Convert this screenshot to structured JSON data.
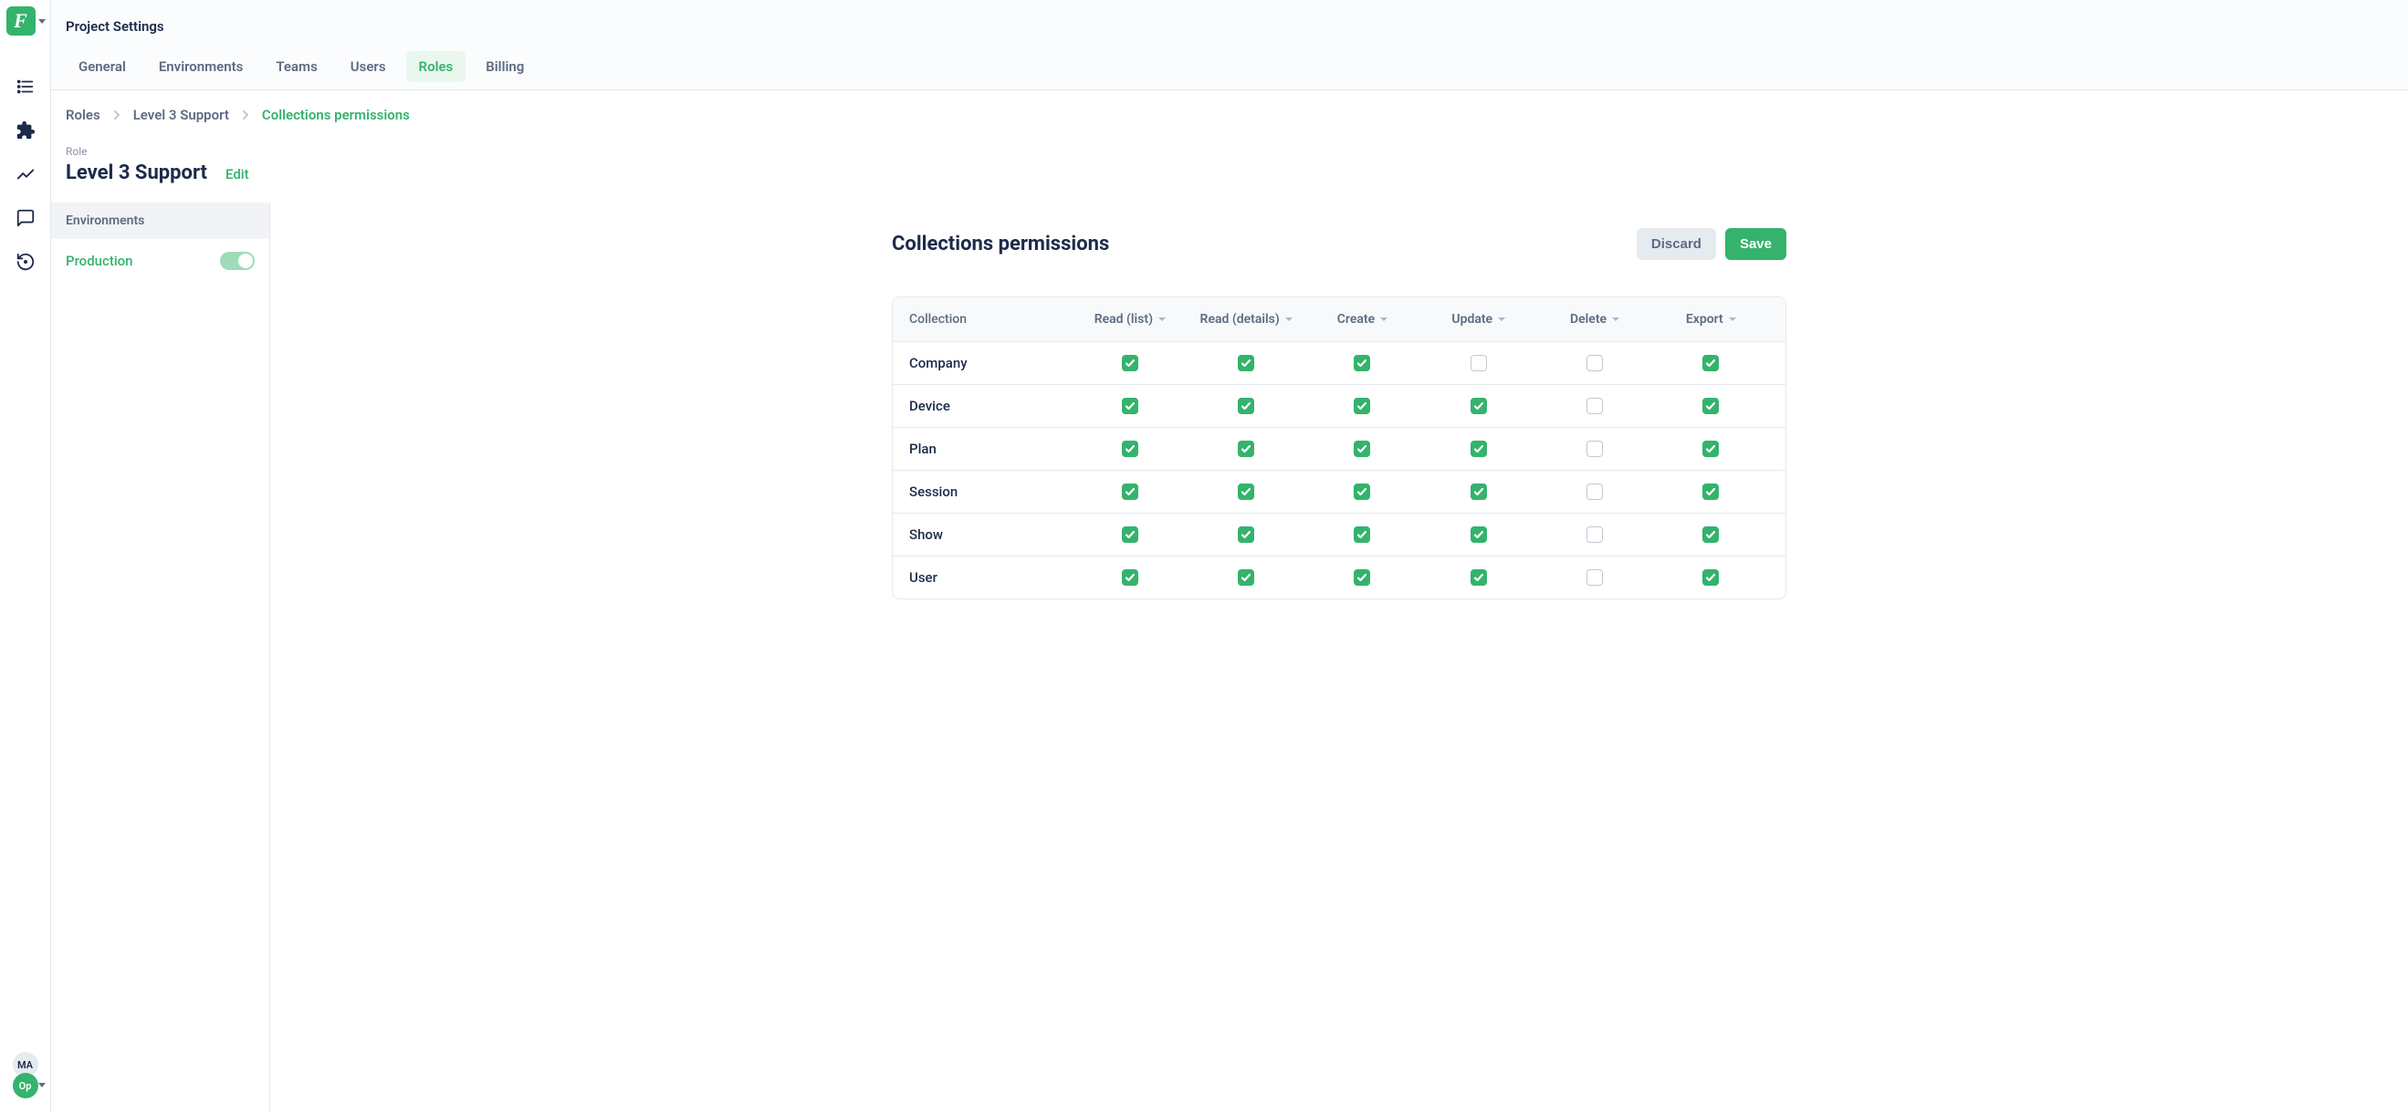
{
  "logo_letter": "F",
  "page_context": "Project Settings",
  "tabs": [
    {
      "label": "General",
      "active": false
    },
    {
      "label": "Environments",
      "active": false
    },
    {
      "label": "Teams",
      "active": false
    },
    {
      "label": "Users",
      "active": false
    },
    {
      "label": "Roles",
      "active": true
    },
    {
      "label": "Billing",
      "active": false
    }
  ],
  "breadcrumbs": [
    {
      "label": "Roles",
      "active": false
    },
    {
      "label": "Level 3 Support",
      "active": false
    },
    {
      "label": "Collections permissions",
      "active": true
    }
  ],
  "role": {
    "section_label": "Role",
    "name": "Level 3 Support",
    "edit_label": "Edit"
  },
  "env_panel": {
    "header": "Environments",
    "items": [
      {
        "name": "Production",
        "on": true
      }
    ]
  },
  "content": {
    "title": "Collections permissions",
    "discard_label": "Discard",
    "save_label": "Save"
  },
  "perm_columns": [
    "Collection",
    "Read (list)",
    "Read (details)",
    "Create",
    "Update",
    "Delete",
    "Export"
  ],
  "perm_rows": [
    {
      "name": "Company",
      "cells": [
        true,
        true,
        true,
        false,
        false,
        true
      ]
    },
    {
      "name": "Device",
      "cells": [
        true,
        true,
        true,
        true,
        false,
        true
      ]
    },
    {
      "name": "Plan",
      "cells": [
        true,
        true,
        true,
        true,
        false,
        true
      ]
    },
    {
      "name": "Session",
      "cells": [
        true,
        true,
        true,
        true,
        false,
        true
      ]
    },
    {
      "name": "Show",
      "cells": [
        true,
        true,
        true,
        true,
        false,
        true
      ]
    },
    {
      "name": "User",
      "cells": [
        true,
        true,
        true,
        true,
        false,
        true
      ]
    }
  ],
  "avatars": [
    {
      "text": "MA",
      "kind": "grey"
    },
    {
      "text": "Op",
      "kind": "green"
    }
  ]
}
